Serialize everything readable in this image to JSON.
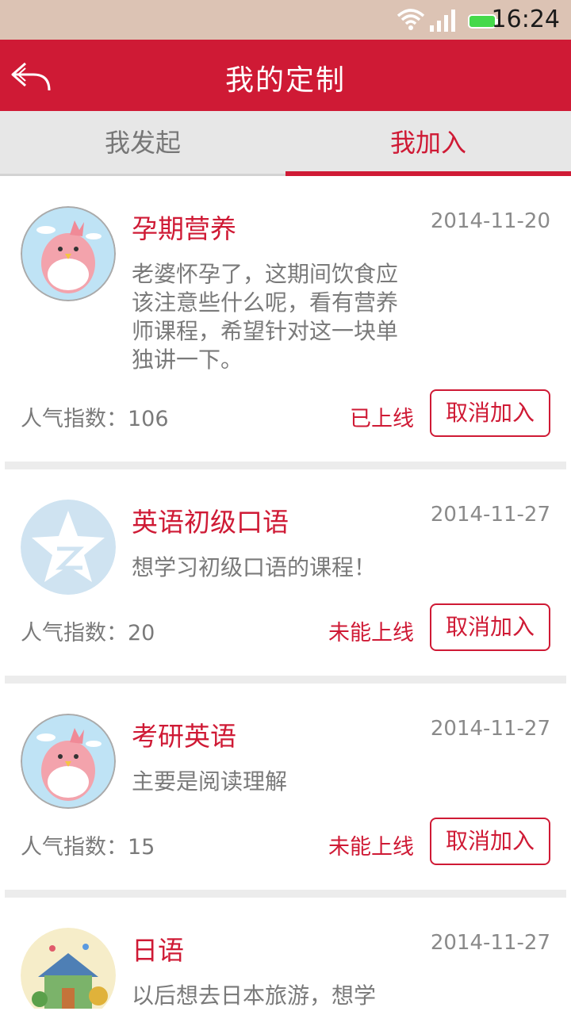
{
  "status_bar": {
    "time": "16:24"
  },
  "header": {
    "title": "我的定制"
  },
  "tabs": [
    {
      "label": "我发起"
    },
    {
      "label": "我加入"
    }
  ],
  "items": [
    {
      "title": "孕期营养",
      "date": "2014-11-20",
      "description": "老婆怀孕了，这期间饮食应该注意些什么呢，看有营养师课程，希望针对这一块单独讲一下。",
      "popularity": "人气指数：106",
      "status": "已上线",
      "action": "取消加入",
      "avatar": "pink-bird-avatar"
    },
    {
      "title": "英语初级口语",
      "date": "2014-11-27",
      "description": "想学习初级口语的课程！",
      "popularity": "人气指数：20",
      "status": "未能上线",
      "action": "取消加入",
      "avatar": "qzone-star-avatar"
    },
    {
      "title": "考研英语",
      "date": "2014-11-27",
      "description": "主要是阅读理解",
      "popularity": "人气指数：15",
      "status": "未能上线",
      "action": "取消加入",
      "avatar": "pink-bird-avatar"
    },
    {
      "title": "日语",
      "date": "2014-11-27",
      "description": "以后想去日本旅游，想学",
      "avatar": "illustrated-house-avatar"
    }
  ],
  "colors": {
    "accent": "#cf1a35",
    "status_bar": "#dcc3b4",
    "tab_bg": "#e7e7e7"
  }
}
